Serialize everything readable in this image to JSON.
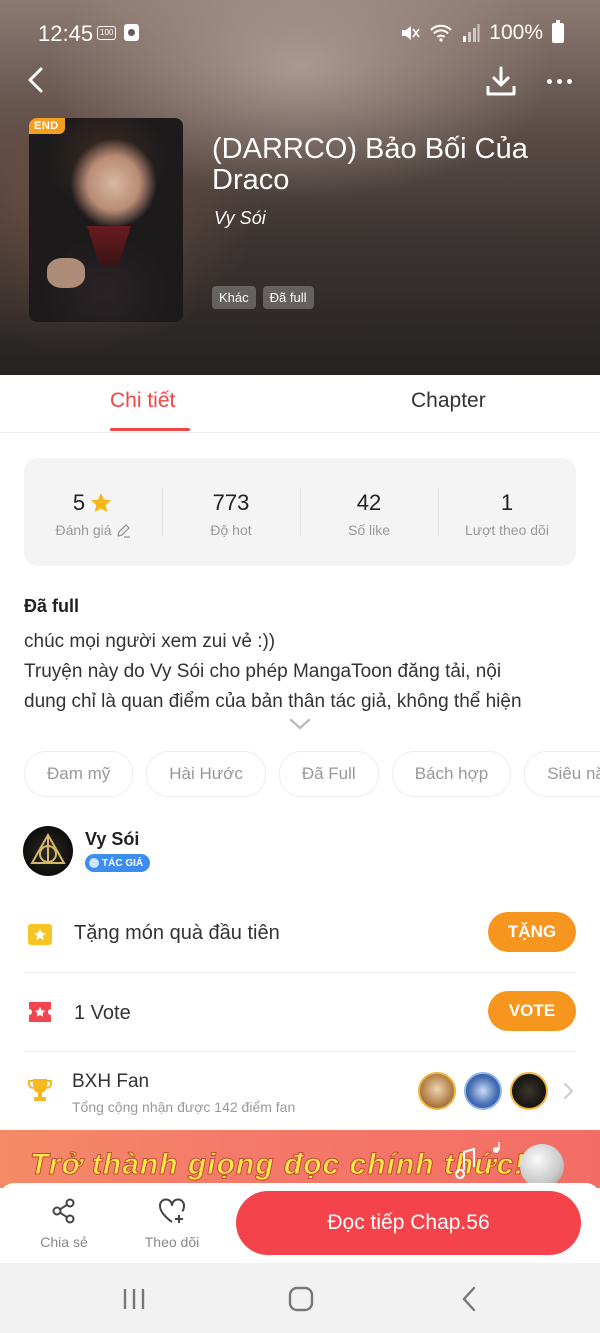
{
  "status_bar": {
    "time": "12:45",
    "small_icon_text": "100",
    "battery": "100%"
  },
  "book": {
    "badge": "END",
    "title": "(DARRCO) Bảo Bối Của Draco",
    "author": "Vy Sói",
    "tags": [
      "Khác",
      "Đã full"
    ]
  },
  "tabs": {
    "detail": "Chi tiết",
    "chapter": "Chapter",
    "active": "detail"
  },
  "stats": [
    {
      "value": "5",
      "label": "Đánh giá"
    },
    {
      "value": "773",
      "label": "Độ hot"
    },
    {
      "value": "42",
      "label": "Số like"
    },
    {
      "value": "1",
      "label": "Lượt theo dõi"
    }
  ],
  "description": {
    "status": "Đã full",
    "lines": [
      "chúc mọi người xem zui vẻ :))",
      "Truyện này do Vy Sói cho phép MangaToon đăng tải, nội",
      "dung chỉ là quan điểm của bản thân tác giả, không thể hiện"
    ]
  },
  "genres": [
    "Đam mỹ",
    "Hài Hước",
    "Đã Full",
    "Bách hợp",
    "Siêu nă"
  ],
  "author_block": {
    "name": "Vy Sói",
    "badge": "TÁC GIẢ"
  },
  "gift_row": {
    "text": "Tặng món quà đầu tiên",
    "button": "TẶNG"
  },
  "vote_row": {
    "text": "1 Vote",
    "button": "VOTE"
  },
  "fan_row": {
    "title": "BXH Fan",
    "subtitle": "Tổng cộng nhận được 142 điểm fan"
  },
  "banner": {
    "text": "Trở thành giọng đọc chính thức!"
  },
  "bottom_bar": {
    "share": "Chia sẻ",
    "follow": "Theo dõi",
    "read": "Đọc tiếp Chap.56"
  },
  "colors": {
    "accent": "#f04646",
    "orange": "#f7961e",
    "read_button": "#f5434b",
    "star": "#f6b81f"
  }
}
